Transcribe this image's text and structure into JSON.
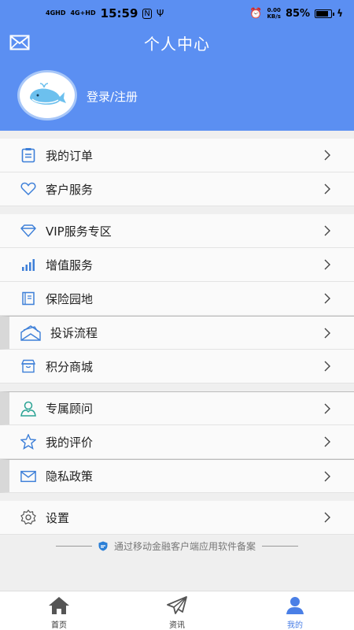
{
  "status_bar": {
    "signal1": "4GHD",
    "signal2": "4G+HD",
    "time": "15:59",
    "speed_value": "0.00",
    "speed_unit": "KB/s",
    "battery": "85%"
  },
  "header": {
    "title": "个人中心",
    "login_text": "登录/注册"
  },
  "menu": {
    "groups": [
      {
        "items": [
          {
            "label": "我的订单",
            "icon": "clipboard-icon"
          },
          {
            "label": "客户服务",
            "icon": "heart-icon"
          }
        ]
      },
      {
        "items": [
          {
            "label": "VIP服务专区",
            "icon": "diamond-icon"
          },
          {
            "label": "增值服务",
            "icon": "bar-chart-icon"
          },
          {
            "label": "保险园地",
            "icon": "book-icon"
          },
          {
            "label": "投诉流程",
            "icon": "envelope-open-icon"
          },
          {
            "label": "积分商城",
            "icon": "store-icon"
          }
        ]
      },
      {
        "items": [
          {
            "label": "专属顾问",
            "icon": "person-icon"
          },
          {
            "label": "我的评价",
            "icon": "star-icon"
          },
          {
            "label": "隐私政策",
            "icon": "mail-icon"
          }
        ]
      },
      {
        "items": [
          {
            "label": "设置",
            "icon": "gear-icon"
          }
        ]
      }
    ]
  },
  "filing_text": "通过移动金融客户端应用软件备案",
  "tabs": [
    {
      "label": "首页",
      "icon": "home-icon"
    },
    {
      "label": "资讯",
      "icon": "paper-plane-icon"
    },
    {
      "label": "我的",
      "icon": "user-icon"
    }
  ],
  "colors": {
    "accent": "#5b8ff2",
    "icon_blue": "#3d7fd8",
    "active_tab": "#4a7fe6"
  }
}
